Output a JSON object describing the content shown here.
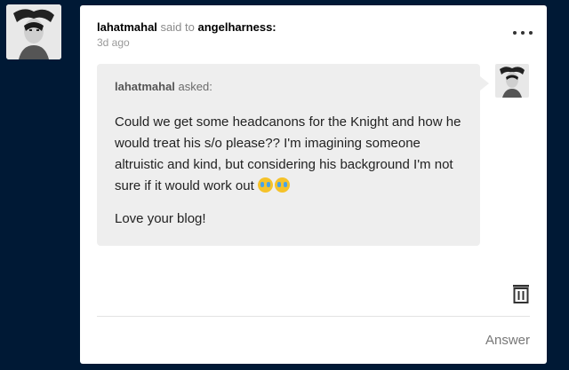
{
  "post": {
    "sender": "lahatmahal",
    "said_to": "said to",
    "recipient": "angelharness:",
    "time": "3d ago"
  },
  "ask": {
    "asker": "lahatmahal",
    "asked_label": "asked:",
    "question": "Could we get some headcanons for the Knight and how he would treat his s/o please?? I'm imagining someone altruistic and kind, but considering his background I'm not sure if it would work out",
    "emojis": [
      "crying-face",
      "crying-face"
    ],
    "closing": "Love your blog!"
  },
  "actions": {
    "answer_label": "Answer",
    "more_icon": "more-horizontal-icon",
    "delete_icon": "trash-icon"
  },
  "colors": {
    "background": "#001935",
    "card": "#ffffff",
    "bubble": "#eeeeee"
  }
}
